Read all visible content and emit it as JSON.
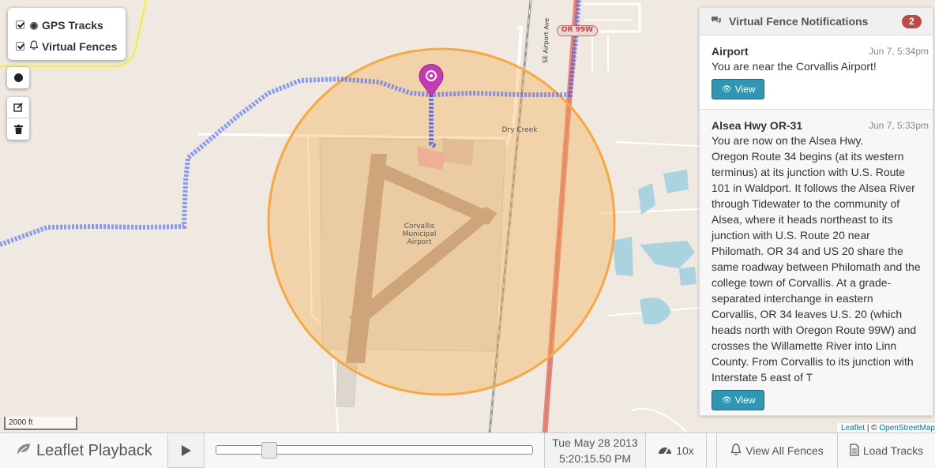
{
  "layers": {
    "items": [
      {
        "label": "GPS Tracks",
        "checked": true,
        "icon": "target-icon"
      },
      {
        "label": "Virtual Fences",
        "checked": true,
        "icon": "bell-icon"
      }
    ]
  },
  "map": {
    "airport_label": "Corvallis\nMunicipal\nAirport",
    "creek_label": "Dry Creek",
    "road_shield": "OR 99W",
    "street_label": "SE Airport Ave",
    "scale": "2000 ft",
    "attribution_leaflet": "Leaflet",
    "attribution_sep": " | © ",
    "attribution_osm": "OpenStreetMap"
  },
  "notifications": {
    "title": "Virtual Fence Notifications",
    "count": "2",
    "items": [
      {
        "title": "Airport",
        "time": "Jun 7, 5:34pm",
        "body": "You are near the Corvallis Airport!",
        "button": "View"
      },
      {
        "title": "Alsea Hwy OR-31",
        "time": "Jun 7, 5:33pm",
        "body": "You are now on the Alsea Hwy.\nOregon Route 34 begins (at its western terminus) at its junction with U.S. Route 101 in Waldport. It follows the Alsea River through Tidewater to the community of Alsea, where it heads northeast to its junction with U.S. Route 20 near Philomath. OR 34 and US 20 share the same roadway between Philomath and the college town of Corvallis. At a grade-separated interchange in eastern Corvallis, OR 34 leaves U.S. 20 (which heads north with Oregon Route 99W) and crosses the Willamette River into Linn County. From Corvallis to its junction with Interstate 5 east of T",
        "button": "View"
      }
    ]
  },
  "playback": {
    "brand": "Leaflet Playback",
    "progress": 0.14,
    "date": "Tue May 28 2013",
    "time": "5:20:15.50 PM",
    "speed": "10x",
    "view_fences": "View All Fences",
    "load_tracks": "Load Tracks"
  },
  "colors": {
    "track": "#3355ff",
    "fence": "#f7a843",
    "marker": "#c33bb0",
    "badge": "#b94a48",
    "button": "#2f96b4"
  }
}
